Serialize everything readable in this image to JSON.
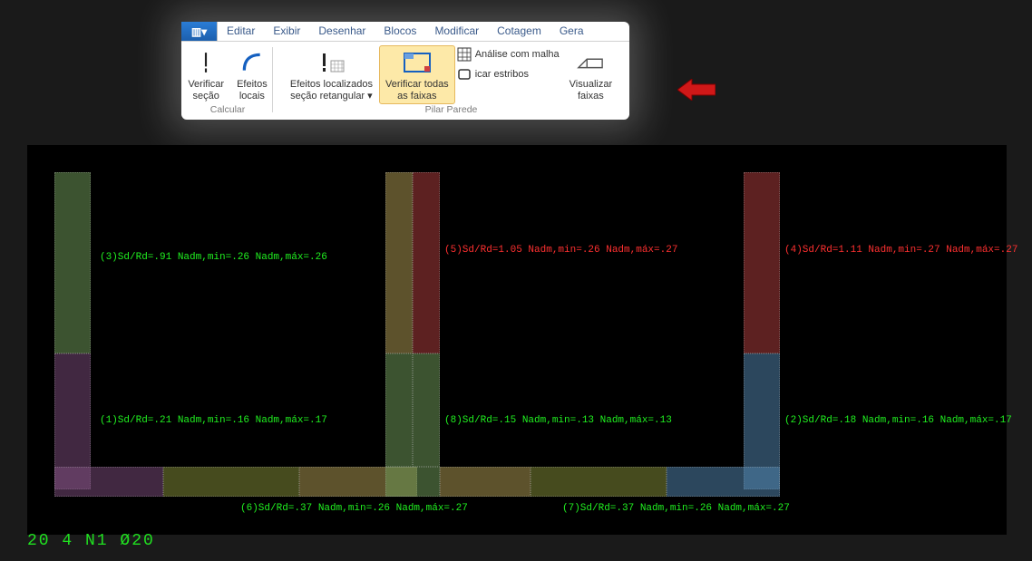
{
  "menu": {
    "appbtn": "▥▾",
    "items": [
      "Editar",
      "Exibir",
      "Desenhar",
      "Blocos",
      "Modificar",
      "Cotagem",
      "Gera"
    ]
  },
  "ribbon": {
    "calc": {
      "verificar_secao": "Verificar\nseção",
      "efeitos_locais": "Efeitos\nlocais",
      "label": "Calcular"
    },
    "pilar": {
      "efeitos_loc_ret": "Efeitos localizados\nseção retangular ▾",
      "verificar_faixas": "Verificar todas\nas faixas",
      "analise_malha": "Análise com malha",
      "verificar_estribos": "icar estribos",
      "visualizar_faixas": "Visualizar\nfaixas",
      "label": "Pilar Parede"
    }
  },
  "annotations": {
    "a1": "(1)Sd/Rd=.21 Nadm,min=.16 Nadm,máx=.17",
    "a2": "(2)Sd/Rd=.18 Nadm,min=.16 Nadm,máx=.17",
    "a3": "(3)Sd/Rd=.91 Nadm,min=.26 Nadm,máx=.26",
    "a4": "(4)Sd/Rd=1.11 Nadm,min=.27 Nadm,máx=.27",
    "a5": "(5)Sd/Rd=1.05 Nadm,min=.26 Nadm,máx=.27",
    "a6": "(6)Sd/Rd=.37 Nadm,min=.26 Nadm,máx=.27",
    "a7": "(7)Sd/Rd=.37 Nadm,min=.26 Nadm,máx=.27",
    "a8": "(8)Sd/Rd=.15 Nadm,min=.13 Nadm,máx=.13"
  },
  "status_left": "20 4 N1 Ø20"
}
